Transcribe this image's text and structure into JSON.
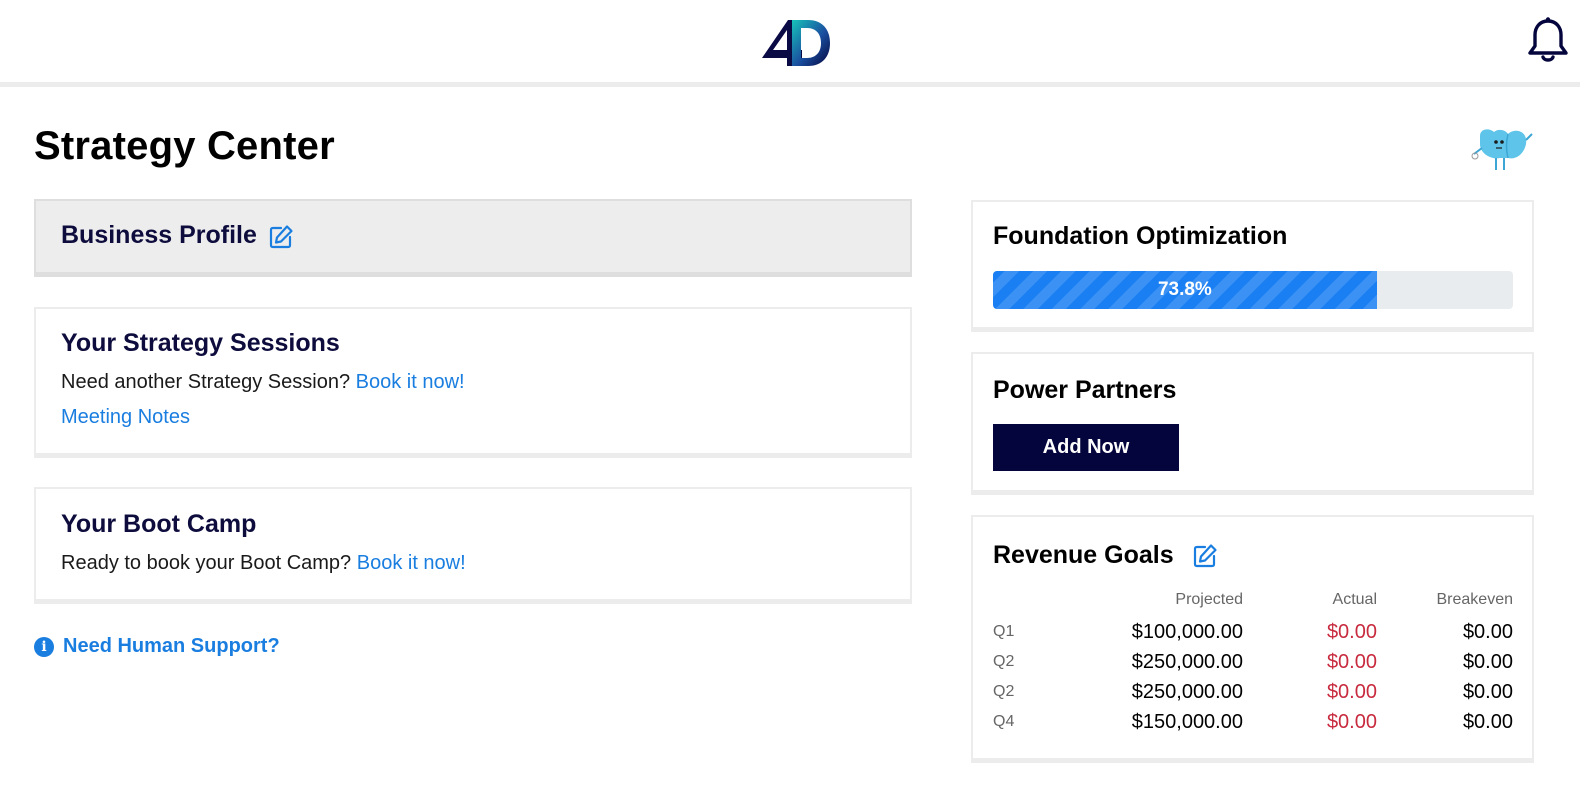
{
  "header": {
    "logo_text": "4D",
    "notifications_icon": "bell-icon"
  },
  "page": {
    "title": "Strategy Center",
    "mascot_icon": "mascot-icon"
  },
  "business_profile": {
    "title": "Business Profile",
    "edit_icon": "edit-icon"
  },
  "strategy_sessions": {
    "title": "Your Strategy Sessions",
    "prompt": "Need another Strategy Session?",
    "book_link": "Book it now!",
    "notes_link": "Meeting Notes"
  },
  "boot_camp": {
    "title": "Your Boot Camp",
    "prompt": "Ready to book your Boot Camp?",
    "book_link": "Book it now!"
  },
  "support": {
    "label": "Need Human Support?",
    "icon": "info-icon"
  },
  "foundation": {
    "title": "Foundation Optimization",
    "progress_percent": 73.8,
    "progress_label": "73.8%"
  },
  "power_partners": {
    "title": "Power Partners",
    "button": "Add Now"
  },
  "revenue_goals": {
    "title": "Revenue Goals",
    "edit_icon": "edit-icon",
    "headers": [
      "",
      "Projected",
      "Actual",
      "Breakeven"
    ],
    "rows": [
      {
        "quarter": "Q1",
        "projected": "$100,000.00",
        "actual": "$0.00",
        "breakeven": "$0.00"
      },
      {
        "quarter": "Q2",
        "projected": "$250,000.00",
        "actual": "$0.00",
        "breakeven": "$0.00"
      },
      {
        "quarter": "Q2",
        "projected": "$250,000.00",
        "actual": "$0.00",
        "breakeven": "$0.00"
      },
      {
        "quarter": "Q4",
        "projected": "$150,000.00",
        "actual": "$0.00",
        "breakeven": "$0.00"
      }
    ]
  },
  "colors": {
    "navy": "#0d0c3d",
    "link": "#1a7ee0",
    "progress": "#1a7ff2",
    "negative": "#c82a3e",
    "button": "#05053d"
  }
}
